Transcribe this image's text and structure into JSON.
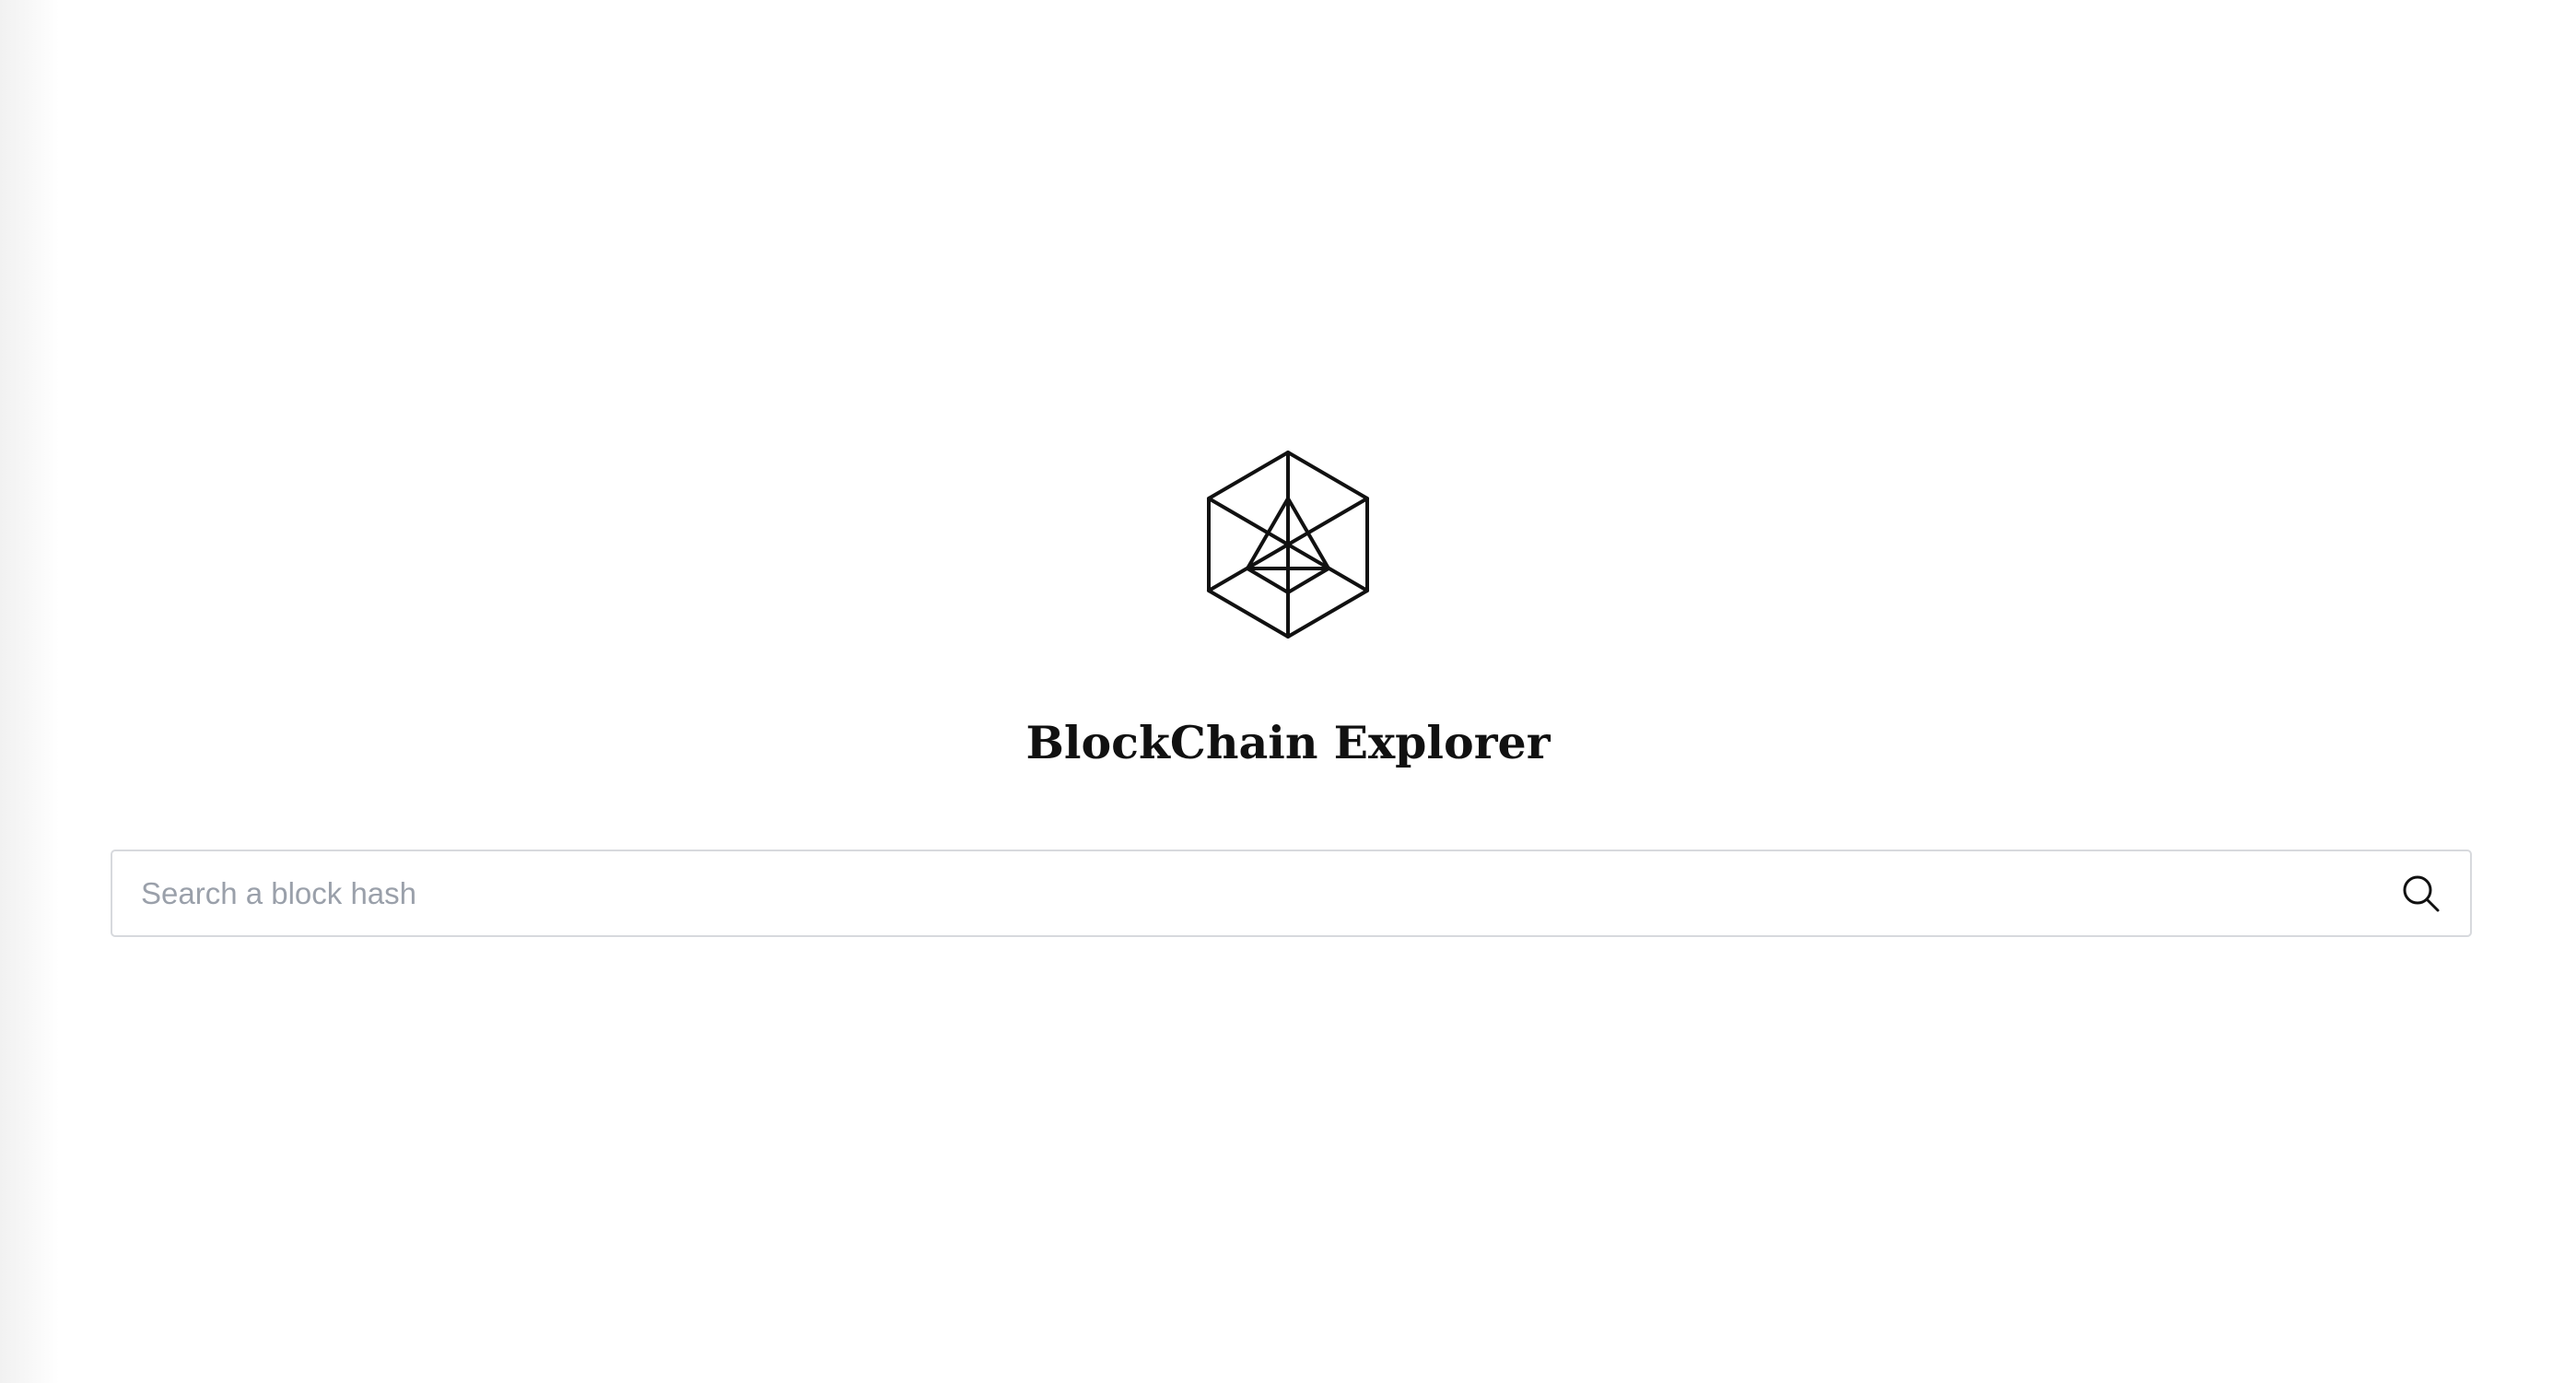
{
  "app": {
    "title": "BlockChain Explorer",
    "logo_icon": "hexagon-cube-icon"
  },
  "search": {
    "placeholder": "Search a block hash",
    "value": "",
    "button_icon": "search-icon"
  },
  "colors": {
    "background": "#ffffff",
    "text": "#111111",
    "placeholder": "#9aa0aa",
    "border": "#d7d9dd"
  }
}
